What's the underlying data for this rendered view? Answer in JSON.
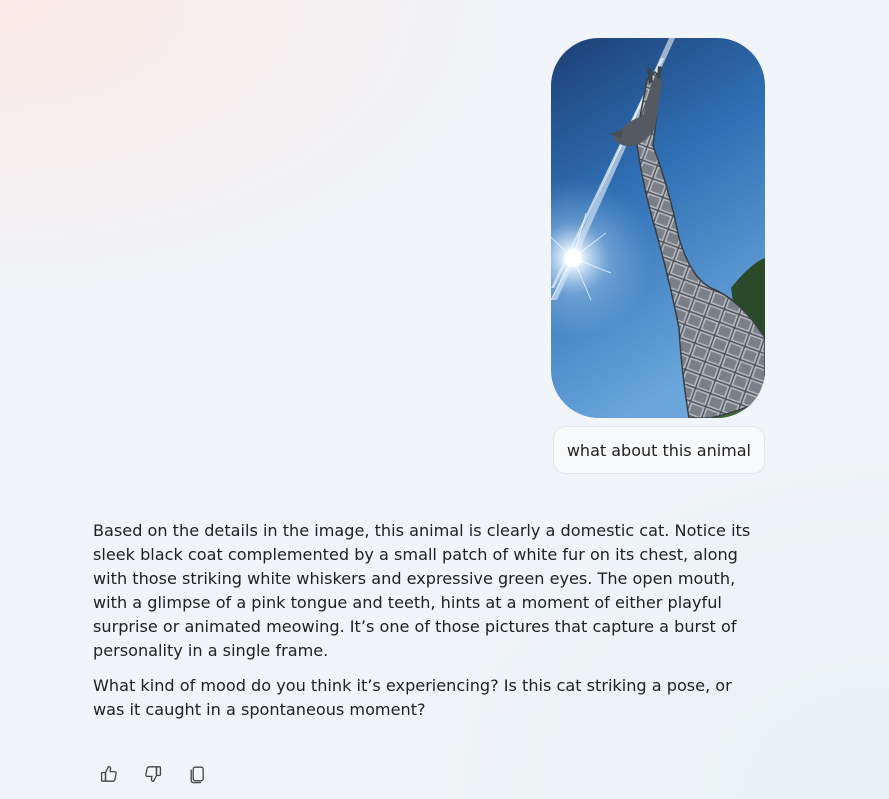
{
  "conversation": {
    "user_message": {
      "image_icon": "photo-giraffe-sky",
      "text": "what about this animal"
    },
    "assistant_message": {
      "paragraphs": [
        "Based on the details in the image, this animal is clearly a domestic cat. Notice its sleek black coat complemented by a small patch of white fur on its chest, along with those striking white whiskers and expressive green eyes. The open mouth, with a glimpse of a pink tongue and teeth, hints at a moment of either playful surprise or animated meowing. It’s one of those pictures that capture a burst of personality in a single frame.",
        "What kind of mood do you think it’s experiencing? Is this cat striking a pose, or was it caught in a spontaneous moment?"
      ]
    },
    "actions": [
      {
        "icon": "thumbs-up-icon"
      },
      {
        "icon": "thumbs-down-icon"
      },
      {
        "icon": "copy-icon"
      }
    ]
  },
  "colors": {
    "background": "#f1f4f8",
    "user_bubble": "#f8f9fb",
    "text": "#202124",
    "icon": "#444444"
  }
}
